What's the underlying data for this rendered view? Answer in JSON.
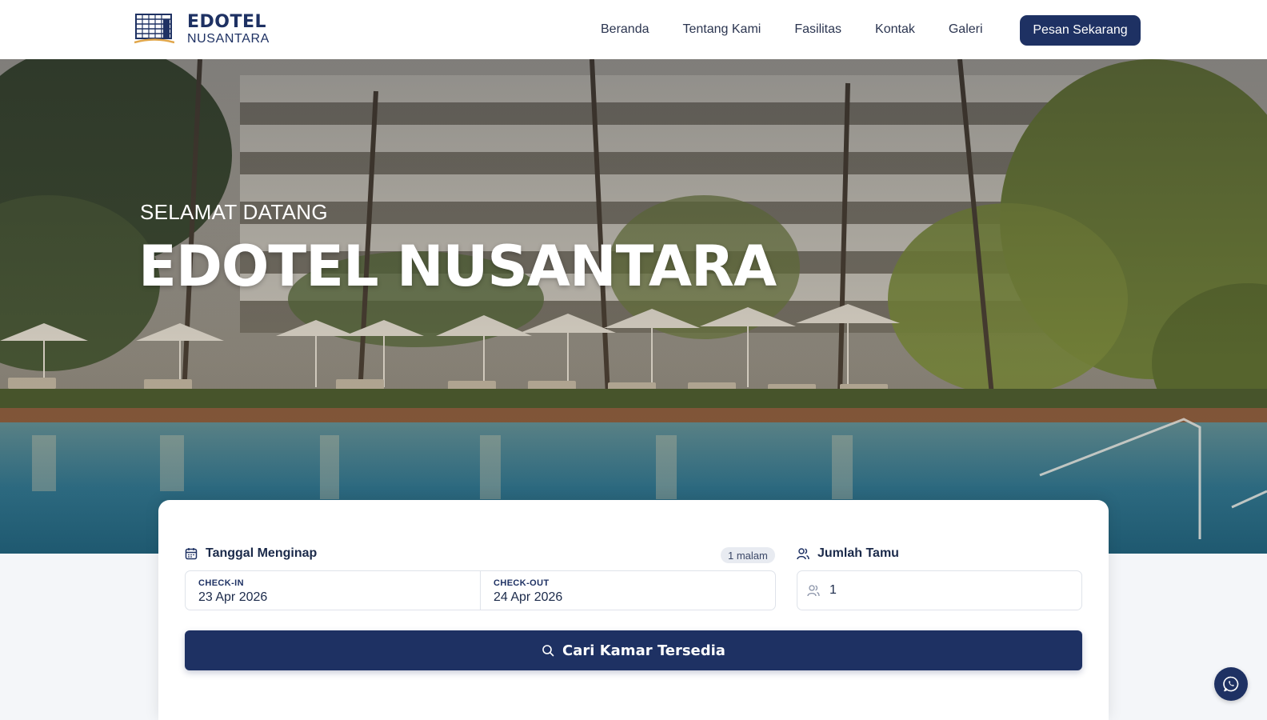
{
  "brand": {
    "title": "EDOTEL",
    "subtitle": "NUSANTARA",
    "logo_icon": "hotel-building-icon"
  },
  "nav": {
    "items": [
      "Beranda",
      "Tentang Kami",
      "Fasilitas",
      "Kontak",
      "Galeri"
    ],
    "cta_label": "Pesan Sekarang"
  },
  "hero": {
    "eyebrow": "SELAMAT DATANG",
    "title": "EDOTEL NUSANTARA",
    "image": "hotel-pool-photo"
  },
  "booking": {
    "dates_label": "Tanggal Menginap",
    "nights_badge": "1 malam",
    "checkin_caption": "CHECK-IN",
    "checkin_value": "23 Apr 2026",
    "checkout_caption": "CHECK-OUT",
    "checkout_value": "24 Apr 2026",
    "guests_label": "Jumlah Tamu",
    "guests_value": "1",
    "search_label": "Cari Kamar Tersedia"
  },
  "colors": {
    "primary": "#1e3163",
    "background": "#f4f6f9",
    "accent_gold": "#e0a64a"
  },
  "icons": {
    "calendar": "calendar-icon",
    "users": "users-icon",
    "search": "search-icon",
    "chat": "whatsapp-icon"
  }
}
